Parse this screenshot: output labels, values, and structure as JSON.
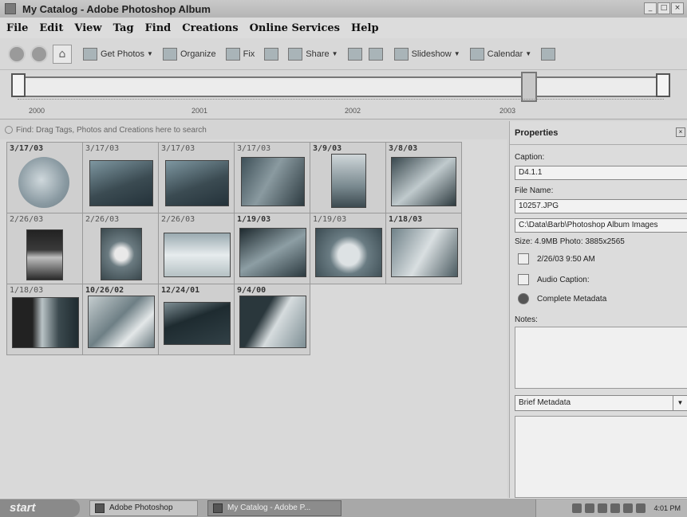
{
  "window": {
    "title": "My Catalog - Adobe Photoshop Album"
  },
  "menu": [
    "File",
    "Edit",
    "View",
    "Tag",
    "Find",
    "Creations",
    "Online Services",
    "Help"
  ],
  "toolbar": {
    "get_photos": "Get Photos",
    "organize": "Organize",
    "fix": "Fix",
    "share": "Share",
    "slideshow": "Slideshow",
    "calendar": "Calendar"
  },
  "timeline": {
    "years": [
      "2000",
      "2001",
      "2002",
      "2003"
    ]
  },
  "findbar": {
    "text": "Find: Drag Tags, Photos and Creations here to search"
  },
  "photos": [
    {
      "date": "3/17/03",
      "bold": true
    },
    {
      "date": "3/17/03",
      "bold": false
    },
    {
      "date": "3/17/03",
      "bold": false
    },
    {
      "date": "3/17/03",
      "bold": false
    },
    {
      "date": "3/9/03",
      "bold": true
    },
    {
      "date": "3/8/03",
      "bold": true
    },
    {
      "date": "2/26/03",
      "bold": false
    },
    {
      "date": "2/26/03",
      "bold": false
    },
    {
      "date": "2/26/03",
      "bold": false
    },
    {
      "date": "1/19/03",
      "bold": true
    },
    {
      "date": "1/19/03",
      "bold": false
    },
    {
      "date": "1/18/03",
      "bold": true
    },
    {
      "date": "1/18/03",
      "bold": false
    },
    {
      "date": "10/26/02",
      "bold": true
    },
    {
      "date": "12/24/01",
      "bold": true
    },
    {
      "date": "9/4/00",
      "bold": true
    }
  ],
  "properties": {
    "header": "Properties",
    "caption_label": "Caption:",
    "caption_value": "D4.1.1",
    "filename_label": "File Name:",
    "filename_value": "10257.JPG",
    "path_value": "C:\\Data\\Barb\\Photoshop Album Images",
    "size_text": "Size: 4.9MB  Photo: 3885x2565",
    "date_text": "2/26/03 9:50 AM",
    "audio_text": "Audio Caption:",
    "metadata_text": "Complete Metadata",
    "notes_label": "Notes:",
    "meta_select": "Brief Metadata"
  },
  "taskbar": {
    "start": "start",
    "tasks": [
      "Adobe Photoshop",
      "My Catalog - Adobe P..."
    ],
    "clock": "4:01 PM"
  }
}
